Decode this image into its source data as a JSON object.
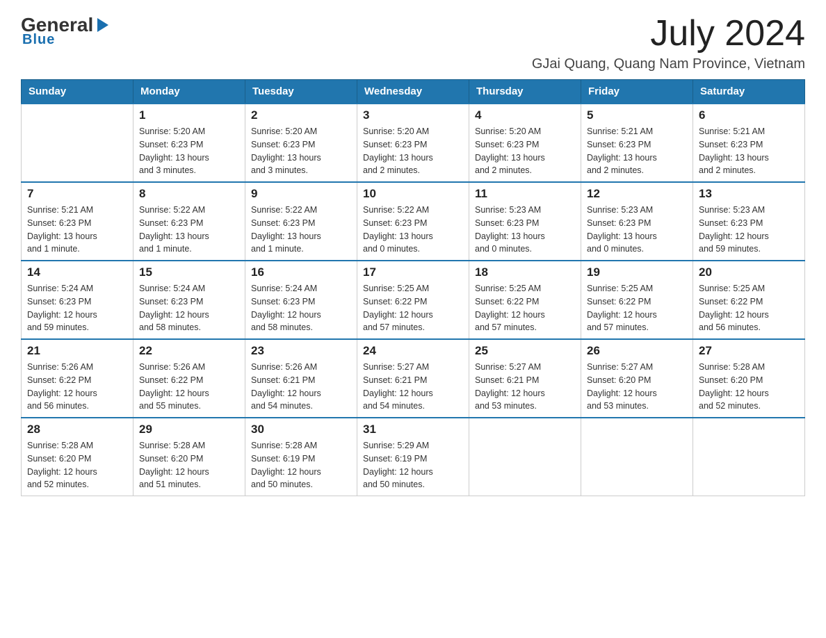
{
  "logo": {
    "general": "General",
    "blue": "Blue",
    "tagline": "Blue"
  },
  "title": {
    "month": "July 2024",
    "location": "GJai Quang, Quang Nam Province, Vietnam"
  },
  "headers": [
    "Sunday",
    "Monday",
    "Tuesday",
    "Wednesday",
    "Thursday",
    "Friday",
    "Saturday"
  ],
  "weeks": [
    [
      {
        "day": "",
        "info": ""
      },
      {
        "day": "1",
        "info": "Sunrise: 5:20 AM\nSunset: 6:23 PM\nDaylight: 13 hours\nand 3 minutes."
      },
      {
        "day": "2",
        "info": "Sunrise: 5:20 AM\nSunset: 6:23 PM\nDaylight: 13 hours\nand 3 minutes."
      },
      {
        "day": "3",
        "info": "Sunrise: 5:20 AM\nSunset: 6:23 PM\nDaylight: 13 hours\nand 2 minutes."
      },
      {
        "day": "4",
        "info": "Sunrise: 5:20 AM\nSunset: 6:23 PM\nDaylight: 13 hours\nand 2 minutes."
      },
      {
        "day": "5",
        "info": "Sunrise: 5:21 AM\nSunset: 6:23 PM\nDaylight: 13 hours\nand 2 minutes."
      },
      {
        "day": "6",
        "info": "Sunrise: 5:21 AM\nSunset: 6:23 PM\nDaylight: 13 hours\nand 2 minutes."
      }
    ],
    [
      {
        "day": "7",
        "info": "Sunrise: 5:21 AM\nSunset: 6:23 PM\nDaylight: 13 hours\nand 1 minute."
      },
      {
        "day": "8",
        "info": "Sunrise: 5:22 AM\nSunset: 6:23 PM\nDaylight: 13 hours\nand 1 minute."
      },
      {
        "day": "9",
        "info": "Sunrise: 5:22 AM\nSunset: 6:23 PM\nDaylight: 13 hours\nand 1 minute."
      },
      {
        "day": "10",
        "info": "Sunrise: 5:22 AM\nSunset: 6:23 PM\nDaylight: 13 hours\nand 0 minutes."
      },
      {
        "day": "11",
        "info": "Sunrise: 5:23 AM\nSunset: 6:23 PM\nDaylight: 13 hours\nand 0 minutes."
      },
      {
        "day": "12",
        "info": "Sunrise: 5:23 AM\nSunset: 6:23 PM\nDaylight: 13 hours\nand 0 minutes."
      },
      {
        "day": "13",
        "info": "Sunrise: 5:23 AM\nSunset: 6:23 PM\nDaylight: 12 hours\nand 59 minutes."
      }
    ],
    [
      {
        "day": "14",
        "info": "Sunrise: 5:24 AM\nSunset: 6:23 PM\nDaylight: 12 hours\nand 59 minutes."
      },
      {
        "day": "15",
        "info": "Sunrise: 5:24 AM\nSunset: 6:23 PM\nDaylight: 12 hours\nand 58 minutes."
      },
      {
        "day": "16",
        "info": "Sunrise: 5:24 AM\nSunset: 6:23 PM\nDaylight: 12 hours\nand 58 minutes."
      },
      {
        "day": "17",
        "info": "Sunrise: 5:25 AM\nSunset: 6:22 PM\nDaylight: 12 hours\nand 57 minutes."
      },
      {
        "day": "18",
        "info": "Sunrise: 5:25 AM\nSunset: 6:22 PM\nDaylight: 12 hours\nand 57 minutes."
      },
      {
        "day": "19",
        "info": "Sunrise: 5:25 AM\nSunset: 6:22 PM\nDaylight: 12 hours\nand 57 minutes."
      },
      {
        "day": "20",
        "info": "Sunrise: 5:25 AM\nSunset: 6:22 PM\nDaylight: 12 hours\nand 56 minutes."
      }
    ],
    [
      {
        "day": "21",
        "info": "Sunrise: 5:26 AM\nSunset: 6:22 PM\nDaylight: 12 hours\nand 56 minutes."
      },
      {
        "day": "22",
        "info": "Sunrise: 5:26 AM\nSunset: 6:22 PM\nDaylight: 12 hours\nand 55 minutes."
      },
      {
        "day": "23",
        "info": "Sunrise: 5:26 AM\nSunset: 6:21 PM\nDaylight: 12 hours\nand 54 minutes."
      },
      {
        "day": "24",
        "info": "Sunrise: 5:27 AM\nSunset: 6:21 PM\nDaylight: 12 hours\nand 54 minutes."
      },
      {
        "day": "25",
        "info": "Sunrise: 5:27 AM\nSunset: 6:21 PM\nDaylight: 12 hours\nand 53 minutes."
      },
      {
        "day": "26",
        "info": "Sunrise: 5:27 AM\nSunset: 6:20 PM\nDaylight: 12 hours\nand 53 minutes."
      },
      {
        "day": "27",
        "info": "Sunrise: 5:28 AM\nSunset: 6:20 PM\nDaylight: 12 hours\nand 52 minutes."
      }
    ],
    [
      {
        "day": "28",
        "info": "Sunrise: 5:28 AM\nSunset: 6:20 PM\nDaylight: 12 hours\nand 52 minutes."
      },
      {
        "day": "29",
        "info": "Sunrise: 5:28 AM\nSunset: 6:20 PM\nDaylight: 12 hours\nand 51 minutes."
      },
      {
        "day": "30",
        "info": "Sunrise: 5:28 AM\nSunset: 6:19 PM\nDaylight: 12 hours\nand 50 minutes."
      },
      {
        "day": "31",
        "info": "Sunrise: 5:29 AM\nSunset: 6:19 PM\nDaylight: 12 hours\nand 50 minutes."
      },
      {
        "day": "",
        "info": ""
      },
      {
        "day": "",
        "info": ""
      },
      {
        "day": "",
        "info": ""
      }
    ]
  ]
}
